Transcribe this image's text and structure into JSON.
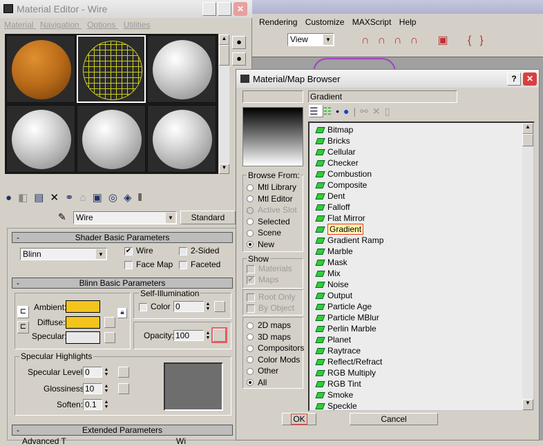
{
  "app": {
    "menu": [
      "Rendering",
      "Customize",
      "MAXScript",
      "Help"
    ],
    "view_dropdown": "View"
  },
  "editor": {
    "title": "Material Editor - Wire",
    "menu": [
      "Material",
      "Navigation",
      "Options",
      "Utilities"
    ],
    "material_name": "Wire",
    "material_type": "Standard",
    "shader_rollout": "Shader Basic Parameters",
    "shader": "Blinn",
    "wire": "Wire",
    "two_sided": "2-Sided",
    "face_map": "Face Map",
    "faceted": "Faceted",
    "blinn_rollout": "Blinn Basic Parameters",
    "ambient": "Ambient:",
    "diffuse": "Diffuse:",
    "specular": "Specular:",
    "self_illum": "Self-Illumination",
    "color_label": "Color",
    "color_value": "0",
    "opacity_label": "Opacity:",
    "opacity_value": "100",
    "spec_highlights": "Specular Highlights",
    "spec_level": "Specular Level:",
    "spec_level_value": "0",
    "glossiness": "Glossiness:",
    "glossiness_value": "10",
    "soften": "Soften:",
    "soften_value": "0.1",
    "extended_rollout": "Extended Parameters",
    "ext_left": "Advanced T",
    "ext_right": "Wi",
    "colors": {
      "ambient": "#f2c41c",
      "diffuse": "#f2c41c",
      "specular": "#e8e8e8"
    }
  },
  "browser": {
    "title": "Material/Map Browser",
    "name_field": "Gradient",
    "browse_from_label": "Browse From:",
    "browse_from": [
      "Mtl Library",
      "Mtl Editor",
      "Active Slot",
      "Selected",
      "Scene",
      "New"
    ],
    "show_label": "Show",
    "show": [
      "Materials",
      "Maps"
    ],
    "root_only": "Root Only",
    "by_object": "By Object",
    "map_types": [
      "2D maps",
      "3D maps",
      "Compositors",
      "Color Mods",
      "Other",
      "All"
    ],
    "items": [
      "Bitmap",
      "Bricks",
      "Cellular",
      "Checker",
      "Combustion",
      "Composite",
      "Dent",
      "Falloff",
      "Flat Mirror",
      "Gradient",
      "Gradient Ramp",
      "Marble",
      "Mask",
      "Mix",
      "Noise",
      "Output",
      "Particle Age",
      "Particle MBlur",
      "Perlin Marble",
      "Planet",
      "Raytrace",
      "Reflect/Refract",
      "RGB Multiply",
      "RGB Tint",
      "Smoke",
      "Speckle"
    ],
    "selected": "Gradient",
    "ok": "OK",
    "cancel": "Cancel"
  }
}
